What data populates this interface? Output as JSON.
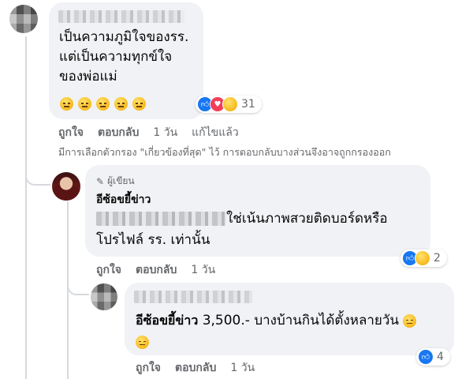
{
  "comment1": {
    "text_lines": [
      "เป็นความภูมิใจของรร.",
      "แต่เป็นความทุกข์ใจ",
      "ของพ่อแม่"
    ],
    "emoji_count": 5,
    "emoji_icon": "expressionless-face-icon",
    "reactions": {
      "icons": [
        "like-icon",
        "love-icon",
        "sad-icon"
      ],
      "count": "31"
    },
    "actions": {
      "like": "ถูกใจ",
      "reply": "ตอบกลับ",
      "time": "1 วัน",
      "edited": "แก้ไขแล้ว"
    }
  },
  "filter_notice": "มีการเลือกตัวกรอง \"เกี่ยวข้องที่สุด\" ไว้ การตอบกลับบางส่วนจึงอาจถูกกรองออก",
  "reply1": {
    "author_badge": "ผู้เขียน",
    "author_name": "อีซ้อขยี้ข่าว",
    "text_part1": "ใช่เน้นภาพสวยติดบอร์ดหรือ",
    "text_line2": "โปรไฟล์ รร. เท่านั้น",
    "reactions": {
      "icons": [
        "like-icon",
        "sad-icon"
      ],
      "count": "2"
    },
    "actions": {
      "like": "ถูกใจ",
      "reply": "ตอบกลับ",
      "time": "1 วัน"
    }
  },
  "reply2": {
    "tag_name": "อีซ้อขยี้ข่าว",
    "text": "3,500.- บางบ้านกินได้ตั้งหลายวัน",
    "reactions": {
      "icons": [
        "like-icon"
      ],
      "count": "4"
    },
    "actions": {
      "like": "ถูกใจ",
      "reply": "ตอบกลับ",
      "time": "1 วัน"
    }
  },
  "colors": {
    "bubble": "#f0f2f5",
    "meta_text": "#65676b",
    "like_blue": "#1877f2",
    "love_red": "#f33e58",
    "thread_line": "#d6d9dd"
  }
}
